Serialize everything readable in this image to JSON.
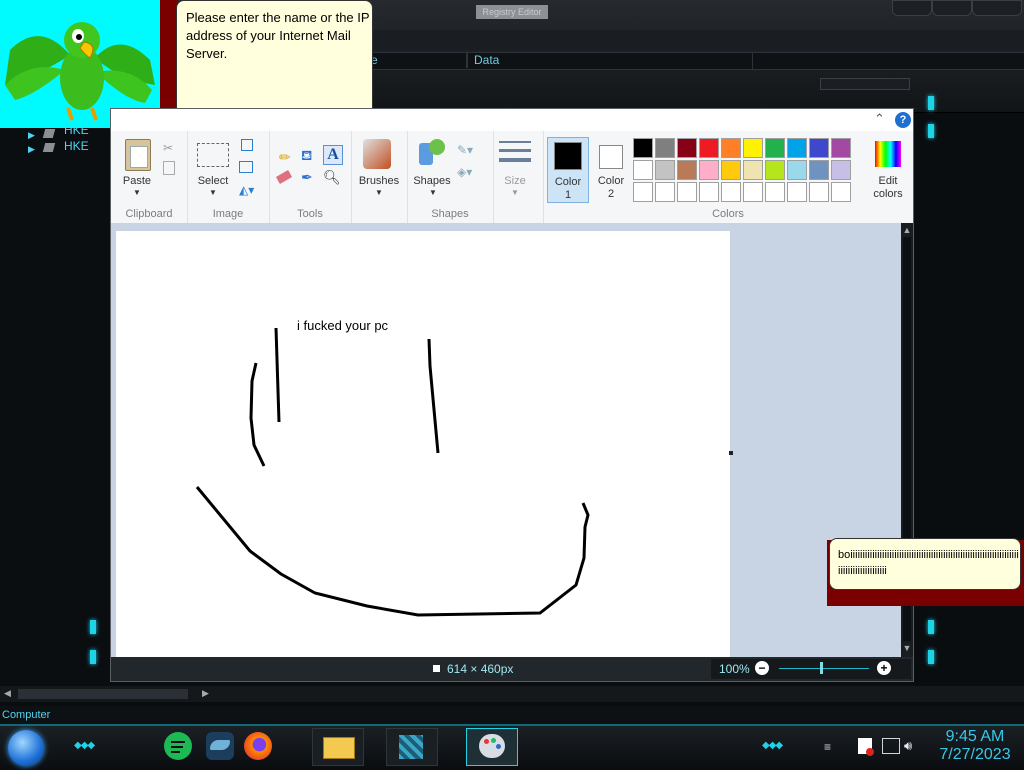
{
  "registry": {
    "title": "Registry Editor",
    "col_partial": "e",
    "col_data": "Data",
    "tree_items": [
      "HKE",
      "HKE"
    ]
  },
  "assistant": {
    "balloon_text": "Please enter the name or the IP address of your Internet Mail Server."
  },
  "chat": {
    "balloon_text": "boiiiiiiiiiiiiiiiiiiiiiiiiiiiiiiiiiiiiiiiiiiiiiiiiiiiiiiiiiiiiiiiiiiiiiiiiiiiiiiiiiiiiiiiii"
  },
  "paint": {
    "groups": {
      "clipboard": "Clipboard",
      "image": "Image",
      "tools": "Tools",
      "shapes": "Shapes",
      "colors": "Colors"
    },
    "buttons": {
      "paste": "Paste",
      "select": "Select",
      "brushes": "Brushes",
      "shapes": "Shapes",
      "size": "Size",
      "color1_a": "Color",
      "color1_b": "1",
      "color2_a": "Color",
      "color2_b": "2",
      "edit_colors_a": "Edit",
      "edit_colors_b": "colors"
    },
    "canvas_text": "i fucked your pc",
    "status_size": "614 × 460px",
    "zoom": "100%",
    "palette_row1": [
      "#000000",
      "#7f7f7f",
      "#880015",
      "#ed1c24",
      "#ff7f27",
      "#fff200",
      "#22b14c",
      "#00a2e8",
      "#3f48cc",
      "#a349a4"
    ],
    "palette_row2": [
      "#ffffff",
      "#c3c3c3",
      "#b97a57",
      "#ffaec9",
      "#ffc90e",
      "#efe4b0",
      "#b5e61d",
      "#99d9ea",
      "#7092be",
      "#c8bfe7"
    ],
    "palette_row3": [
      "#ffffff",
      "#ffffff",
      "#ffffff",
      "#ffffff",
      "#ffffff",
      "#ffffff",
      "#ffffff",
      "#ffffff",
      "#ffffff",
      "#ffffff"
    ],
    "color1": "#000000",
    "color2": "#ffffff"
  },
  "explorer": {
    "status": "Computer"
  },
  "taskbar": {
    "time": "9:45 AM",
    "date": "7/27/2023",
    "icons": [
      "start-orb-icon",
      "spotify-icon",
      "dolphin-icon",
      "firefox-icon",
      "file-explorer-icon",
      "registry-cubes-icon",
      "paint-icon"
    ]
  }
}
